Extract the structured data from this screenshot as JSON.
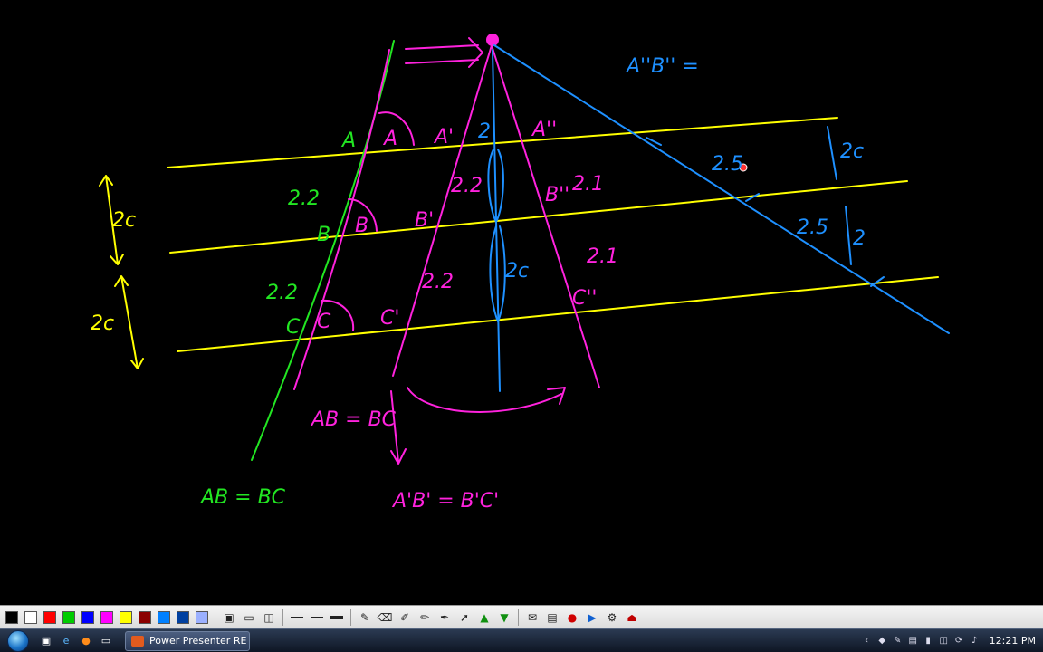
{
  "board": {
    "label_A": "A",
    "label_B": "B",
    "label_C": "C",
    "label_A1": "A'",
    "label_B1": "B'",
    "label_C1": "C'",
    "label_A2": "A''",
    "label_B2": "B''",
    "label_C2": "C''",
    "label_A2B2_eq": "A''B'' =",
    "val_2c_left": "2c",
    "val_2c_left2": "2c",
    "val_22_green_1": "2.2",
    "val_22_green_2": "2.2",
    "val_22_pink_1": "2.2",
    "val_22_pink_2": "2.2",
    "val_2_mid": "2",
    "val_2c_mid": "2c",
    "val_21_1": "2.1",
    "val_21_2": "2.1",
    "val_25_1": "2.5",
    "val_25_2": "2.5",
    "val_2c_right": "2c",
    "val_2_right": "2",
    "eq_green": "AB = BC",
    "eq_pink1": "AB = BC",
    "eq_pink2": "A'B' = B'C'"
  },
  "colors": {
    "yellow": "#ffff00",
    "green": "#22e622",
    "pink": "#ff22dd",
    "blue": "#1e90ff",
    "background": "#000000"
  },
  "toolbar": {
    "palette": [
      "#000000",
      "#ffffff",
      "#ff0000",
      "#00cc00",
      "#0000ff",
      "#ff00ff",
      "#ffff00",
      "#8b0000",
      "#0080ff",
      "#0040a0",
      "#9bb0ff"
    ],
    "tools": [
      "display-icon",
      "monitor-icon",
      "screen-icon",
      "line-thin-icon",
      "line-medium-icon",
      "line-thick-icon",
      "pencil-icon",
      "eraser-icon",
      "marker-icon",
      "brush-icon",
      "highlighter-icon",
      "cursor-icon",
      "arrow-up-icon",
      "arrow-down-icon",
      "envelope-icon",
      "save-icon",
      "record-icon",
      "play-icon",
      "settings-icon",
      "exit-icon"
    ]
  },
  "taskbar": {
    "task_label": "Power Presenter RE",
    "clock": "12:21 PM"
  }
}
